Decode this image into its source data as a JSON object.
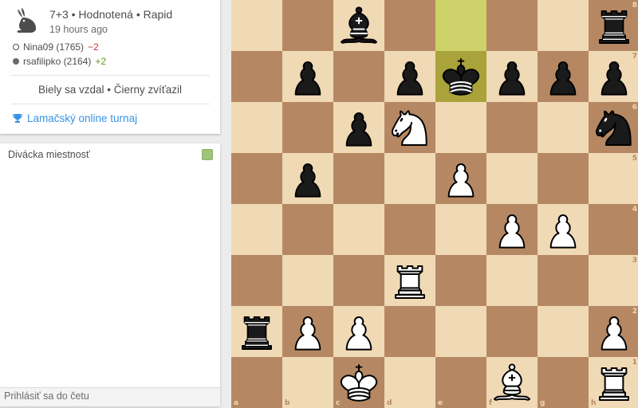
{
  "game": {
    "line1": "7+3 • Hodnotená • Rapid",
    "line2": "19 hours ago",
    "icon": "rabbit-icon",
    "players": [
      {
        "name": "Nina09 (1765)",
        "diff": "−2",
        "color": "white"
      },
      {
        "name": "rsafilipko (2164)",
        "diff": "+2",
        "color": "black"
      }
    ],
    "result": "Biely sa vzdal • Čierny zvíťazil",
    "tournament": "Lamačský online turnaj",
    "tournament_icon": "trophy-icon"
  },
  "chat": {
    "title": "Divácka miestnosť",
    "input_placeholder": "Prihlásiť sa do četu"
  },
  "board": {
    "light_color": "#f0d9b5",
    "dark_color": "#b58863",
    "highlight": [
      "e8",
      "e7"
    ],
    "files": [
      "a",
      "b",
      "c",
      "d",
      "e",
      "f",
      "g",
      "h"
    ],
    "ranks": [
      "8",
      "7",
      "6",
      "5",
      "4",
      "3",
      "2",
      "1"
    ],
    "pieces": [
      {
        "square": "c8",
        "type": "bishop",
        "color": "black"
      },
      {
        "square": "h8",
        "type": "rook",
        "color": "black"
      },
      {
        "square": "b7",
        "type": "pawn",
        "color": "black"
      },
      {
        "square": "d7",
        "type": "pawn",
        "color": "black"
      },
      {
        "square": "e7",
        "type": "king",
        "color": "black"
      },
      {
        "square": "f7",
        "type": "pawn",
        "color": "black"
      },
      {
        "square": "g7",
        "type": "pawn",
        "color": "black"
      },
      {
        "square": "h7",
        "type": "pawn",
        "color": "black"
      },
      {
        "square": "c6",
        "type": "pawn",
        "color": "black"
      },
      {
        "square": "d6",
        "type": "knight",
        "color": "white"
      },
      {
        "square": "h6",
        "type": "knight",
        "color": "black"
      },
      {
        "square": "b5",
        "type": "pawn",
        "color": "black"
      },
      {
        "square": "e5",
        "type": "pawn",
        "color": "white"
      },
      {
        "square": "f4",
        "type": "pawn",
        "color": "white"
      },
      {
        "square": "g4",
        "type": "pawn",
        "color": "white"
      },
      {
        "square": "d3",
        "type": "rook",
        "color": "white"
      },
      {
        "square": "a2",
        "type": "rook",
        "color": "black"
      },
      {
        "square": "b2",
        "type": "pawn",
        "color": "white"
      },
      {
        "square": "c2",
        "type": "pawn",
        "color": "white"
      },
      {
        "square": "h2",
        "type": "pawn",
        "color": "white"
      },
      {
        "square": "c1",
        "type": "king",
        "color": "white"
      },
      {
        "square": "f1",
        "type": "bishop",
        "color": "white"
      },
      {
        "square": "h1",
        "type": "rook",
        "color": "white"
      }
    ]
  }
}
